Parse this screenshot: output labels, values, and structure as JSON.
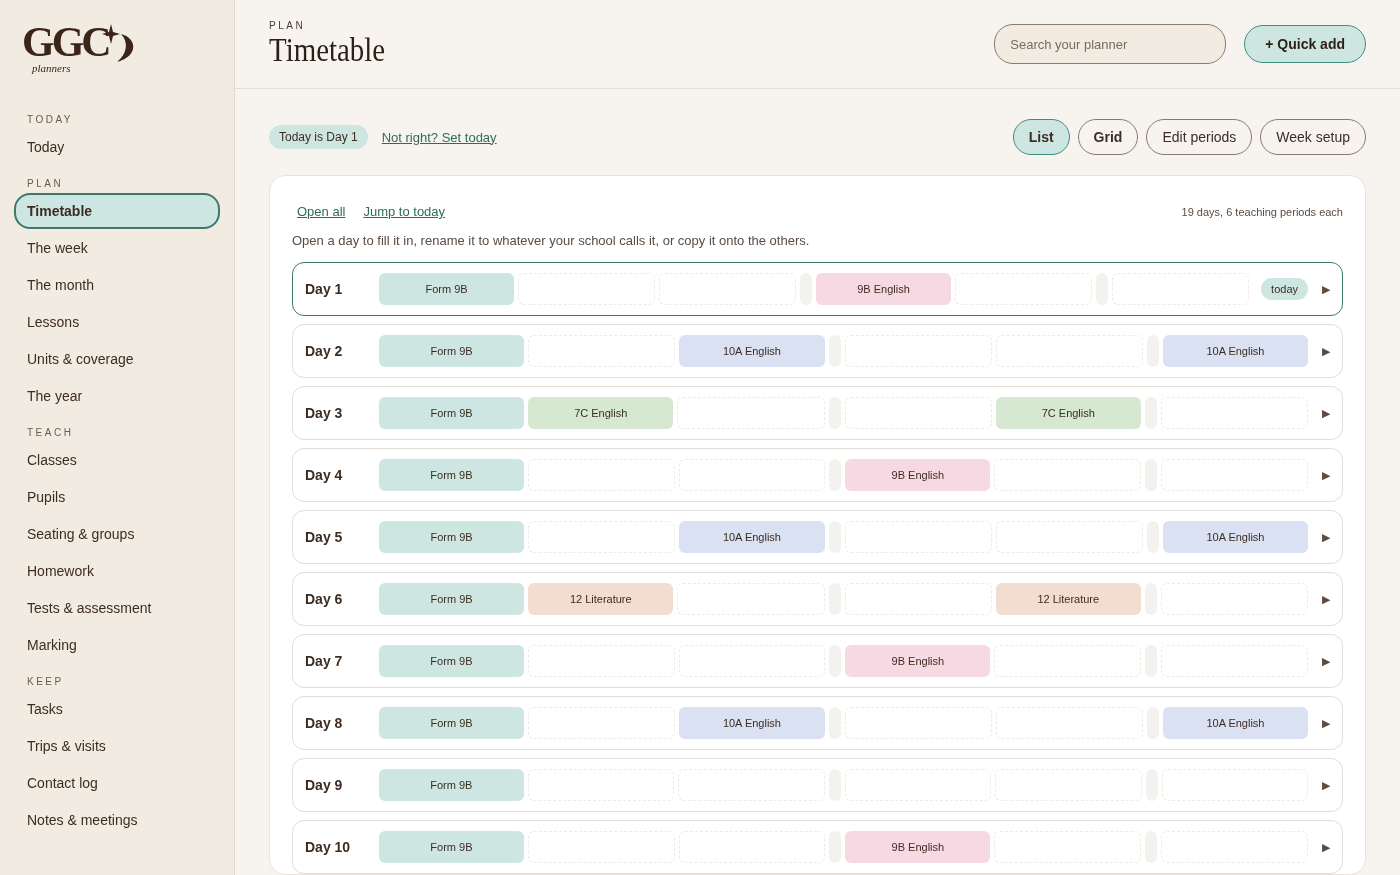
{
  "logo": {
    "mark": "GGC",
    "sub": "planners"
  },
  "sidebar": {
    "sections": [
      {
        "heading": "TODAY",
        "items": [
          {
            "label": "Today",
            "selected": false
          }
        ]
      },
      {
        "heading": "PLAN",
        "items": [
          {
            "label": "Timetable",
            "selected": true
          },
          {
            "label": "The week",
            "selected": false
          },
          {
            "label": "The month",
            "selected": false
          },
          {
            "label": "Lessons",
            "selected": false
          },
          {
            "label": "Units & coverage",
            "selected": false
          },
          {
            "label": "The year",
            "selected": false
          }
        ]
      },
      {
        "heading": "TEACH",
        "items": [
          {
            "label": "Classes",
            "selected": false
          },
          {
            "label": "Pupils",
            "selected": false
          },
          {
            "label": "Seating & groups",
            "selected": false
          },
          {
            "label": "Homework",
            "selected": false
          },
          {
            "label": "Tests & assessment",
            "selected": false
          },
          {
            "label": "Marking",
            "selected": false
          }
        ]
      },
      {
        "heading": "KEEP",
        "items": [
          {
            "label": "Tasks",
            "selected": false
          },
          {
            "label": "Trips & visits",
            "selected": false
          },
          {
            "label": "Contact log",
            "selected": false
          },
          {
            "label": "Notes & meetings",
            "selected": false
          }
        ]
      }
    ]
  },
  "header": {
    "eyebrow": "PLAN",
    "title": "Timetable",
    "search": {
      "placeholder": "Search your planner"
    },
    "quick_add": "+ Quick add"
  },
  "toolbar": {
    "today_pill": "Today is Day 1",
    "set_today_link": "Not right? Set today",
    "views": [
      {
        "label": "List",
        "selected": true
      },
      {
        "label": "Grid",
        "selected": false
      }
    ],
    "actions": [
      "Edit periods",
      "Week setup"
    ]
  },
  "panel": {
    "links": [
      "Open all",
      "Jump to today"
    ],
    "summary": "19 days, 6 teaching periods each",
    "hint": "Open a day to fill it in, rename it to whatever your school calls it, or copy it onto the others.",
    "days": [
      {
        "name": "Day 1",
        "current": true,
        "badge": "today",
        "toggle": "▶",
        "slots": [
          {
            "kind": "lesson",
            "label": "Form 9B",
            "color": "#cde6e1"
          },
          {
            "kind": "free"
          },
          {
            "kind": "free"
          },
          {
            "kind": "break"
          },
          {
            "kind": "lesson",
            "label": "9B English",
            "color": "#f7d9e4"
          },
          {
            "kind": "free"
          },
          {
            "kind": "break"
          },
          {
            "kind": "free"
          }
        ]
      },
      {
        "name": "Day 2",
        "current": false,
        "toggle": "▶",
        "slots": [
          {
            "kind": "lesson",
            "label": "Form 9B",
            "color": "#cde6e1"
          },
          {
            "kind": "free"
          },
          {
            "kind": "lesson",
            "label": "10A English",
            "color": "#d9e1f2"
          },
          {
            "kind": "break"
          },
          {
            "kind": "free"
          },
          {
            "kind": "free"
          },
          {
            "kind": "break"
          },
          {
            "kind": "lesson",
            "label": "10A English",
            "color": "#d9e1f2"
          }
        ]
      },
      {
        "name": "Day 3",
        "current": false,
        "toggle": "▶",
        "slots": [
          {
            "kind": "lesson",
            "label": "Form 9B",
            "color": "#cde6e1"
          },
          {
            "kind": "lesson",
            "label": "7C English",
            "color": "#d6e8d2"
          },
          {
            "kind": "free"
          },
          {
            "kind": "break"
          },
          {
            "kind": "free"
          },
          {
            "kind": "lesson",
            "label": "7C English",
            "color": "#d6e8d2"
          },
          {
            "kind": "break"
          },
          {
            "kind": "free"
          }
        ]
      },
      {
        "name": "Day 4",
        "current": false,
        "toggle": "▶",
        "slots": [
          {
            "kind": "lesson",
            "label": "Form 9B",
            "color": "#cde6e1"
          },
          {
            "kind": "free"
          },
          {
            "kind": "free"
          },
          {
            "kind": "break"
          },
          {
            "kind": "lesson",
            "label": "9B English",
            "color": "#f7d9e4"
          },
          {
            "kind": "free"
          },
          {
            "kind": "break"
          },
          {
            "kind": "free"
          }
        ]
      },
      {
        "name": "Day 5",
        "current": false,
        "toggle": "▶",
        "slots": [
          {
            "kind": "lesson",
            "label": "Form 9B",
            "color": "#cde6e1"
          },
          {
            "kind": "free"
          },
          {
            "kind": "lesson",
            "label": "10A English",
            "color": "#d9e1f2"
          },
          {
            "kind": "break"
          },
          {
            "kind": "free"
          },
          {
            "kind": "free"
          },
          {
            "kind": "break"
          },
          {
            "kind": "lesson",
            "label": "10A English",
            "color": "#d9e1f2"
          }
        ]
      },
      {
        "name": "Day 6",
        "current": false,
        "toggle": "▶",
        "slots": [
          {
            "kind": "lesson",
            "label": "Form 9B",
            "color": "#cde6e1"
          },
          {
            "kind": "lesson",
            "label": "12 Literature",
            "color": "#f3ddd0"
          },
          {
            "kind": "free"
          },
          {
            "kind": "break"
          },
          {
            "kind": "free"
          },
          {
            "kind": "lesson",
            "label": "12 Literature",
            "color": "#f3ddd0"
          },
          {
            "kind": "break"
          },
          {
            "kind": "free"
          }
        ]
      },
      {
        "name": "Day 7",
        "current": false,
        "toggle": "▶",
        "slots": [
          {
            "kind": "lesson",
            "label": "Form 9B",
            "color": "#cde6e1"
          },
          {
            "kind": "free"
          },
          {
            "kind": "free"
          },
          {
            "kind": "break"
          },
          {
            "kind": "lesson",
            "label": "9B English",
            "color": "#f7d9e4"
          },
          {
            "kind": "free"
          },
          {
            "kind": "break"
          },
          {
            "kind": "free"
          }
        ]
      },
      {
        "name": "Day 8",
        "current": false,
        "toggle": "▶",
        "slots": [
          {
            "kind": "lesson",
            "label": "Form 9B",
            "color": "#cde6e1"
          },
          {
            "kind": "free"
          },
          {
            "kind": "lesson",
            "label": "10A English",
            "color": "#d9e1f2"
          },
          {
            "kind": "break"
          },
          {
            "kind": "free"
          },
          {
            "kind": "free"
          },
          {
            "kind": "break"
          },
          {
            "kind": "lesson",
            "label": "10A English",
            "color": "#d9e1f2"
          }
        ]
      },
      {
        "name": "Day 9",
        "current": false,
        "toggle": "▶",
        "slots": [
          {
            "kind": "lesson",
            "label": "Form 9B",
            "color": "#cde6e1"
          },
          {
            "kind": "free"
          },
          {
            "kind": "free"
          },
          {
            "kind": "break"
          },
          {
            "kind": "free"
          },
          {
            "kind": "free"
          },
          {
            "kind": "break"
          },
          {
            "kind": "free"
          }
        ]
      },
      {
        "name": "Day 10",
        "current": false,
        "toggle": "▶",
        "slots": [
          {
            "kind": "lesson",
            "label": "Form 9B",
            "color": "#cde6e1"
          },
          {
            "kind": "free"
          },
          {
            "kind": "free"
          },
          {
            "kind": "break"
          },
          {
            "kind": "lesson",
            "label": "9B English",
            "color": "#f7d9e4"
          },
          {
            "kind": "free"
          },
          {
            "kind": "break"
          },
          {
            "kind": "free"
          }
        ]
      }
    ]
  }
}
